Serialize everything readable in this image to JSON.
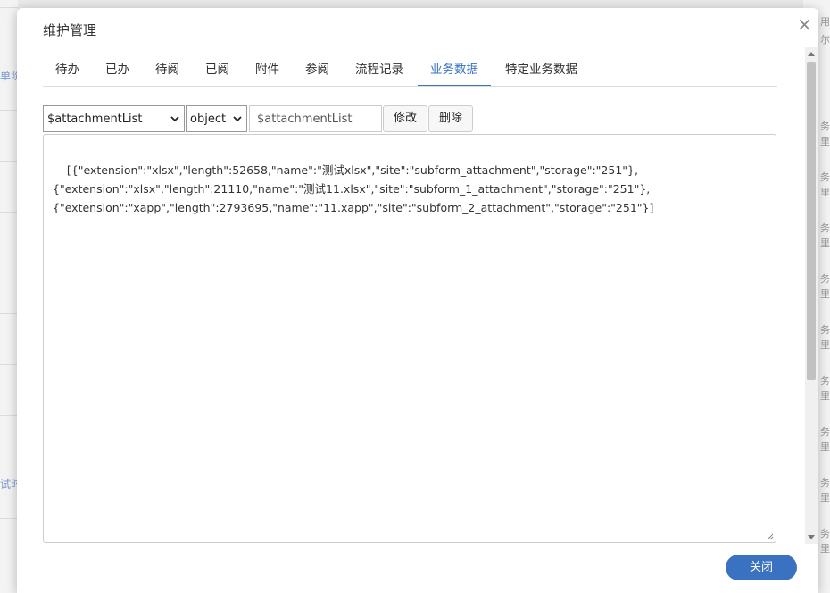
{
  "background": {
    "left_labels": [
      "单阶",
      "试时"
    ],
    "right_labels": [
      "用",
      "尔",
      "务",
      "里",
      "务",
      "里",
      "务",
      "里",
      "务",
      "里",
      "务",
      "里",
      "务",
      "里",
      "务",
      "里",
      "务",
      "里",
      "务",
      "里"
    ]
  },
  "dialog": {
    "title": "维护管理",
    "close_symbol": "×",
    "tabs": [
      {
        "label": "待办",
        "active": false
      },
      {
        "label": "已办",
        "active": false
      },
      {
        "label": "待阅",
        "active": false
      },
      {
        "label": "已阅",
        "active": false
      },
      {
        "label": "附件",
        "active": false
      },
      {
        "label": "参阅",
        "active": false
      },
      {
        "label": "流程记录",
        "active": false
      },
      {
        "label": "业务数据",
        "active": true
      },
      {
        "label": "特定业务数据",
        "active": false
      }
    ],
    "toolbar": {
      "variable_select": "$attachmentList",
      "type_select": "object",
      "name_input": "$attachmentList",
      "modify_label": "修改",
      "delete_label": "删除"
    },
    "editor_text": "[{\"extension\":\"xlsx\",\"length\":52658,\"name\":\"测试xlsx\",\"site\":\"subform_attachment\",\"storage\":\"251\"},\n{\"extension\":\"xlsx\",\"length\":21110,\"name\":\"测试11.xlsx\",\"site\":\"subform_1_attachment\",\"storage\":\"251\"},\n{\"extension\":\"xapp\",\"length\":2793695,\"name\":\"11.xapp\",\"site\":\"subform_2_attachment\",\"storage\":\"251\"}]",
    "close_button_label": "关闭"
  },
  "colors": {
    "accent": "#3b71c1",
    "active_tab": "#3a73c4"
  }
}
